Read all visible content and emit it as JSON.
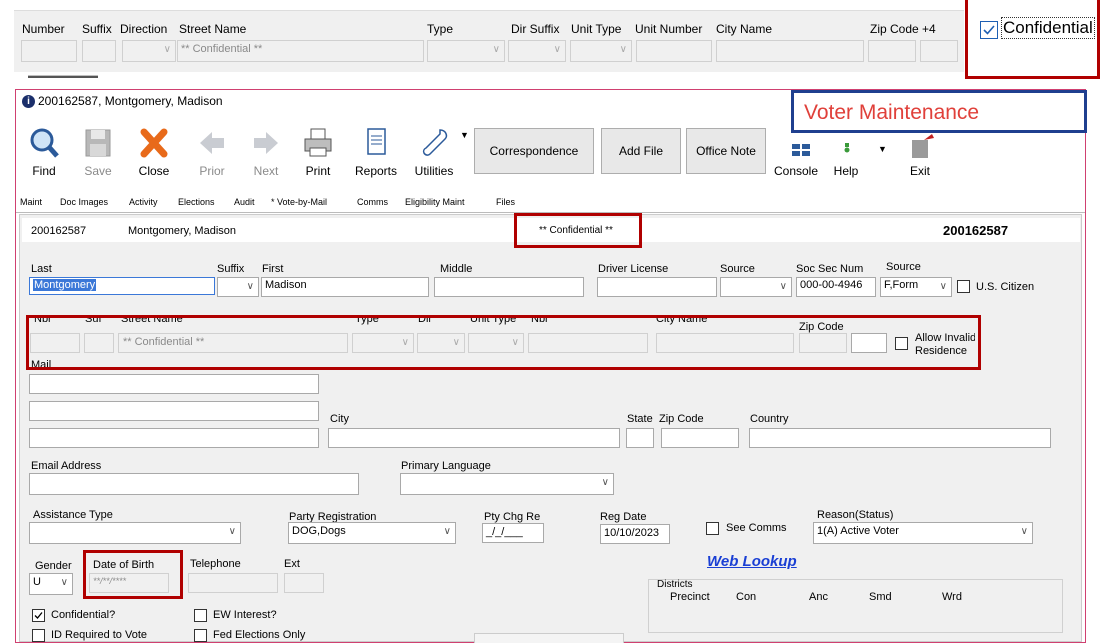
{
  "top_strip": {
    "headers": [
      "Number",
      "Suffix",
      "Direction",
      "Street Name",
      "Type",
      "Dir Suffix",
      "Unit Type",
      "Unit Number",
      "City Name",
      "Zip Code +4"
    ],
    "street_value": "** Confidential **",
    "confidential_label": "Confidential"
  },
  "window": {
    "title": "200162587, Montgomery, Madison",
    "banner": "Voter Maintenance"
  },
  "toolbar": {
    "find": "Find",
    "save": "Save",
    "close": "Close",
    "prior": "Prior",
    "next": "Next",
    "print": "Print",
    "reports": "Reports",
    "utilities": "Utilities",
    "correspondence": "Correspondence",
    "add_file": "Add File",
    "office_note": "Office Note",
    "console": "Console",
    "help": "Help",
    "exit": "Exit"
  },
  "tabs": [
    "Maint",
    "Doc Images",
    "Activity",
    "Elections",
    "Audit",
    "* Vote-by-Mail",
    "Comms",
    "Eligibility Maint",
    "Files"
  ],
  "header": {
    "voter_id": "200162587",
    "voter_name": "Montgomery, Madison",
    "confidential": "** Confidential **",
    "voter_id_right": "200162587"
  },
  "name_row": {
    "last_label": "Last",
    "last_value": "Montgomery",
    "suffix_label": "Suffix",
    "first_label": "First",
    "first_value": "Madison",
    "middle_label": "Middle",
    "dl_label": "Driver License",
    "source_label": "Source",
    "ssn_label": "Soc Sec Num",
    "ssn_value": "000-00-4946",
    "source2_label": "Source",
    "source2_value": "F,Form",
    "citizen_label": "U.S. Citizen"
  },
  "residence": {
    "headers": [
      "Nbr",
      "Suf",
      "Street Name",
      "Type",
      "Dir",
      "Unit Type",
      "Nbr",
      "City Name",
      "Zip Code"
    ],
    "street_value": "** Confidential **",
    "allow_invalid_label_1": "Allow Invalid",
    "allow_invalid_label_2": "Residence"
  },
  "mail": {
    "label": "Mail",
    "city_label": "City",
    "state_label": "State",
    "zip_label": "Zip Code",
    "country_label": "Country"
  },
  "contact": {
    "email_label": "Email Address",
    "language_label": "Primary Language"
  },
  "registration": {
    "assistance_label": "Assistance Type",
    "party_label": "Party Registration",
    "party_value": "DOG,Dogs",
    "pty_chg_label": "Pty Chg Re",
    "pty_chg_value": "_/_/___",
    "reg_date_label": "Reg Date",
    "reg_date_value": "10/10/2023",
    "see_comms_label": "See Comms",
    "reason_label": "Reason(Status)",
    "reason_value": "1(A) Active Voter"
  },
  "personal": {
    "gender_label": "Gender",
    "gender_value": "U",
    "dob_label": "Date of Birth",
    "dob_value": "**/**/****",
    "telephone_label": "Telephone",
    "ext_label": "Ext",
    "web_lookup": "Web Lookup"
  },
  "districts": {
    "title": "Districts",
    "columns": [
      "Precinct",
      "Con",
      "Anc",
      "Smd",
      "Wrd"
    ]
  },
  "flags": {
    "confidential": "Confidential?",
    "ew_interest": "EW Interest?",
    "id_required": "ID Required to Vote",
    "fed_only": "Fed Elections Only"
  },
  "colors": {
    "highlight_red": "#b00000",
    "banner_red": "#e0403a",
    "banner_border": "#1f3f8f",
    "link_blue": "#1a3fd4",
    "window_border": "#d04070",
    "selection_blue": "#3b78d8"
  }
}
